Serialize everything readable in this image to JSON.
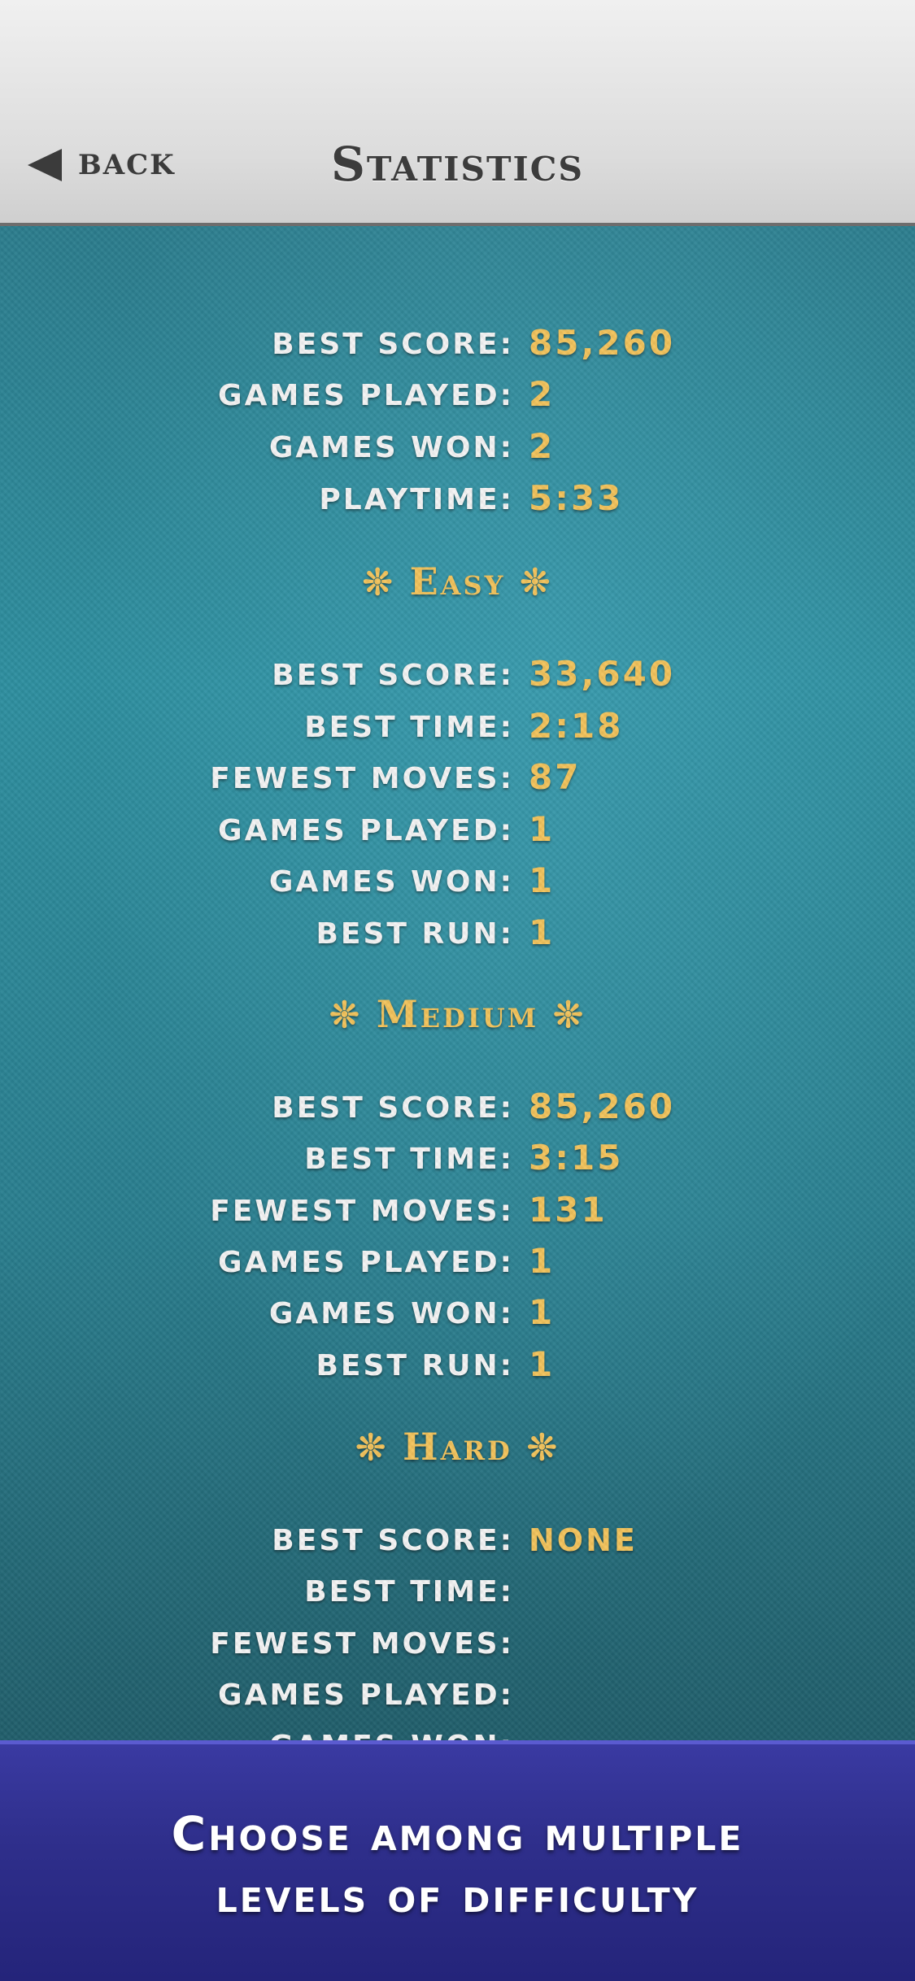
{
  "header": {
    "back_label": "BACK",
    "title": "Statistics"
  },
  "overall": [
    {
      "label": "BEST SCORE:",
      "value": "85,260"
    },
    {
      "label": "GAMES PLAYED:",
      "value": "2"
    },
    {
      "label": "GAMES WON:",
      "value": "2"
    },
    {
      "label": "PLAYTIME:",
      "value": "5:33"
    }
  ],
  "sections": [
    {
      "title": "Easy",
      "rows": [
        {
          "label": "BEST SCORE:",
          "value": "33,640"
        },
        {
          "label": "BEST TIME:",
          "value": "2:18"
        },
        {
          "label": "FEWEST MOVES:",
          "value": "87"
        },
        {
          "label": "GAMES PLAYED:",
          "value": "1"
        },
        {
          "label": "GAMES WON:",
          "value": "1"
        },
        {
          "label": "BEST RUN:",
          "value": "1"
        }
      ]
    },
    {
      "title": "Medium",
      "rows": [
        {
          "label": "BEST SCORE:",
          "value": "85,260"
        },
        {
          "label": "BEST TIME:",
          "value": "3:15"
        },
        {
          "label": "FEWEST MOVES:",
          "value": "131"
        },
        {
          "label": "GAMES PLAYED:",
          "value": "1"
        },
        {
          "label": "GAMES WON:",
          "value": "1"
        },
        {
          "label": "BEST RUN:",
          "value": "1"
        }
      ]
    },
    {
      "title": "Hard",
      "rows": [
        {
          "label": "BEST SCORE:",
          "value": "NONE"
        },
        {
          "label": "BEST TIME:",
          "value": ""
        },
        {
          "label": "FEWEST MOVES:",
          "value": ""
        },
        {
          "label": "GAMES PLAYED:",
          "value": ""
        },
        {
          "label": "GAMES WON:",
          "value": ""
        }
      ]
    }
  ],
  "ornament": "❊",
  "banner": {
    "line1": "Choose among multiple",
    "line2": "levels of difficulty"
  },
  "colors": {
    "value_gold": "#f2c35c",
    "felt": "#2e8fa0",
    "banner": "#2f2f8c"
  }
}
